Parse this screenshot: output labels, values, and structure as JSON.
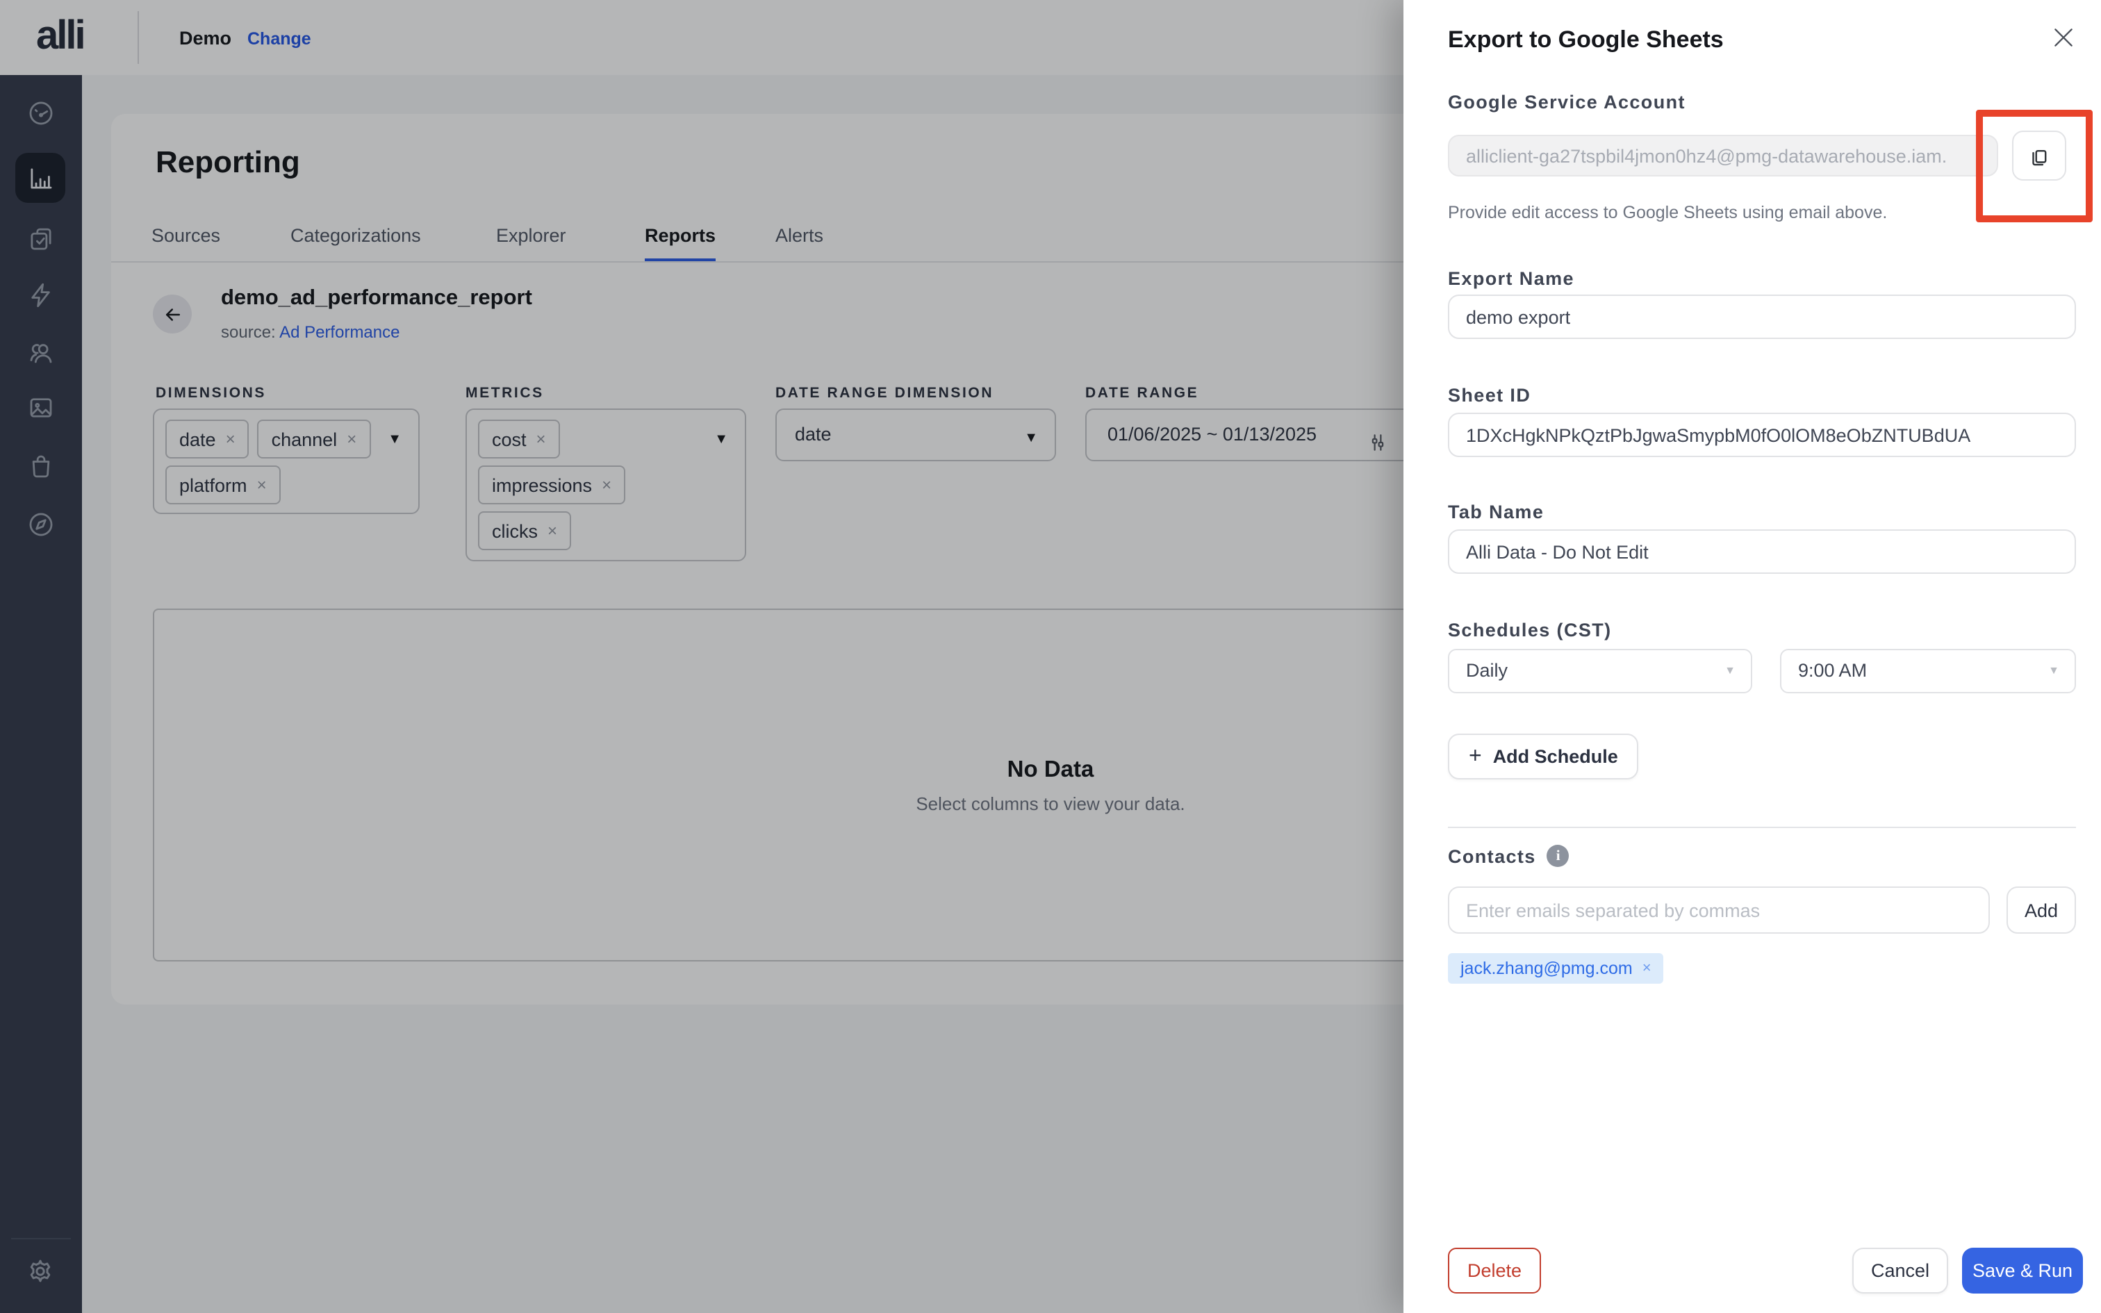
{
  "header": {
    "logo": "alli",
    "workspace": "Demo",
    "change_link": "Change"
  },
  "sidebar": {
    "icons": [
      "dashboard-gauge",
      "bar-chart",
      "clipboard-check",
      "lightning",
      "users",
      "image",
      "shopping-bag",
      "compass"
    ],
    "active_icon": "bar-chart",
    "settings_icon": "gear"
  },
  "reporting": {
    "title": "Reporting",
    "tabs": [
      {
        "label": "Sources",
        "active": false
      },
      {
        "label": "Categorizations",
        "active": false
      },
      {
        "label": "Explorer",
        "active": false
      },
      {
        "label": "Reports",
        "active": true
      },
      {
        "label": "Alerts",
        "active": false
      }
    ],
    "report": {
      "name": "demo_ad_performance_report",
      "source_label": "source:",
      "source_link": "Ad Performance"
    },
    "filters": {
      "dimensions": {
        "label": "DIMENSIONS",
        "chips": [
          "date",
          "channel",
          "platform"
        ]
      },
      "metrics": {
        "label": "METRICS",
        "chips": [
          "cost",
          "impressions",
          "clicks"
        ]
      },
      "date_range_dimension": {
        "label": "DATE RANGE DIMENSION",
        "value": "date"
      },
      "date_range": {
        "label": "DATE RANGE",
        "value": "01/06/2025 ~ 01/13/2025"
      }
    },
    "empty_state": {
      "title": "No Data",
      "subtitle": "Select columns to view your data."
    }
  },
  "export_panel": {
    "title": "Export to Google Sheets",
    "service_account": {
      "label": "Google Service Account",
      "value": "alliclient-ga27tspbil4jmon0hz4@pmg-datawarehouse.iam.",
      "helper": "Provide edit access to Google Sheets using email above."
    },
    "export_name": {
      "label": "Export Name",
      "value": "demo export"
    },
    "sheet_id": {
      "label": "Sheet ID",
      "value": "1DXcHgkNPkQztPbJgwaSmypbM0fO0lOM8eObZNTUBdUA"
    },
    "tab_name": {
      "label": "Tab Name",
      "value": "Alli Data - Do Not Edit"
    },
    "schedules": {
      "label": "Schedules (CST)",
      "frequency": "Daily",
      "time": "9:00 AM",
      "add_button": "Add Schedule",
      "plus_glyph": "+"
    },
    "contacts": {
      "label": "Contacts",
      "info_glyph": "i",
      "placeholder": "Enter emails separated by commas",
      "add_button": "Add",
      "chips": [
        {
          "email": "jack.zhang@pmg.com",
          "remove_glyph": "×"
        }
      ]
    },
    "footer": {
      "delete": "Delete",
      "cancel": "Cancel",
      "save": "Save & Run"
    }
  },
  "glyphs": {
    "chip_remove": "×",
    "caret_down": "▼",
    "caret_small": "▼"
  },
  "colors": {
    "accent_blue": "#2c5ce5",
    "link_blue": "#2457e6",
    "save_button_blue": "#3564e2",
    "delete_red": "#c23d2d",
    "annotation_red": "#e8432a",
    "sidebar_bg": "#353c4d",
    "sidebar_active_bg": "#1b202b",
    "chip_blue_bg": "#dcebfb"
  }
}
